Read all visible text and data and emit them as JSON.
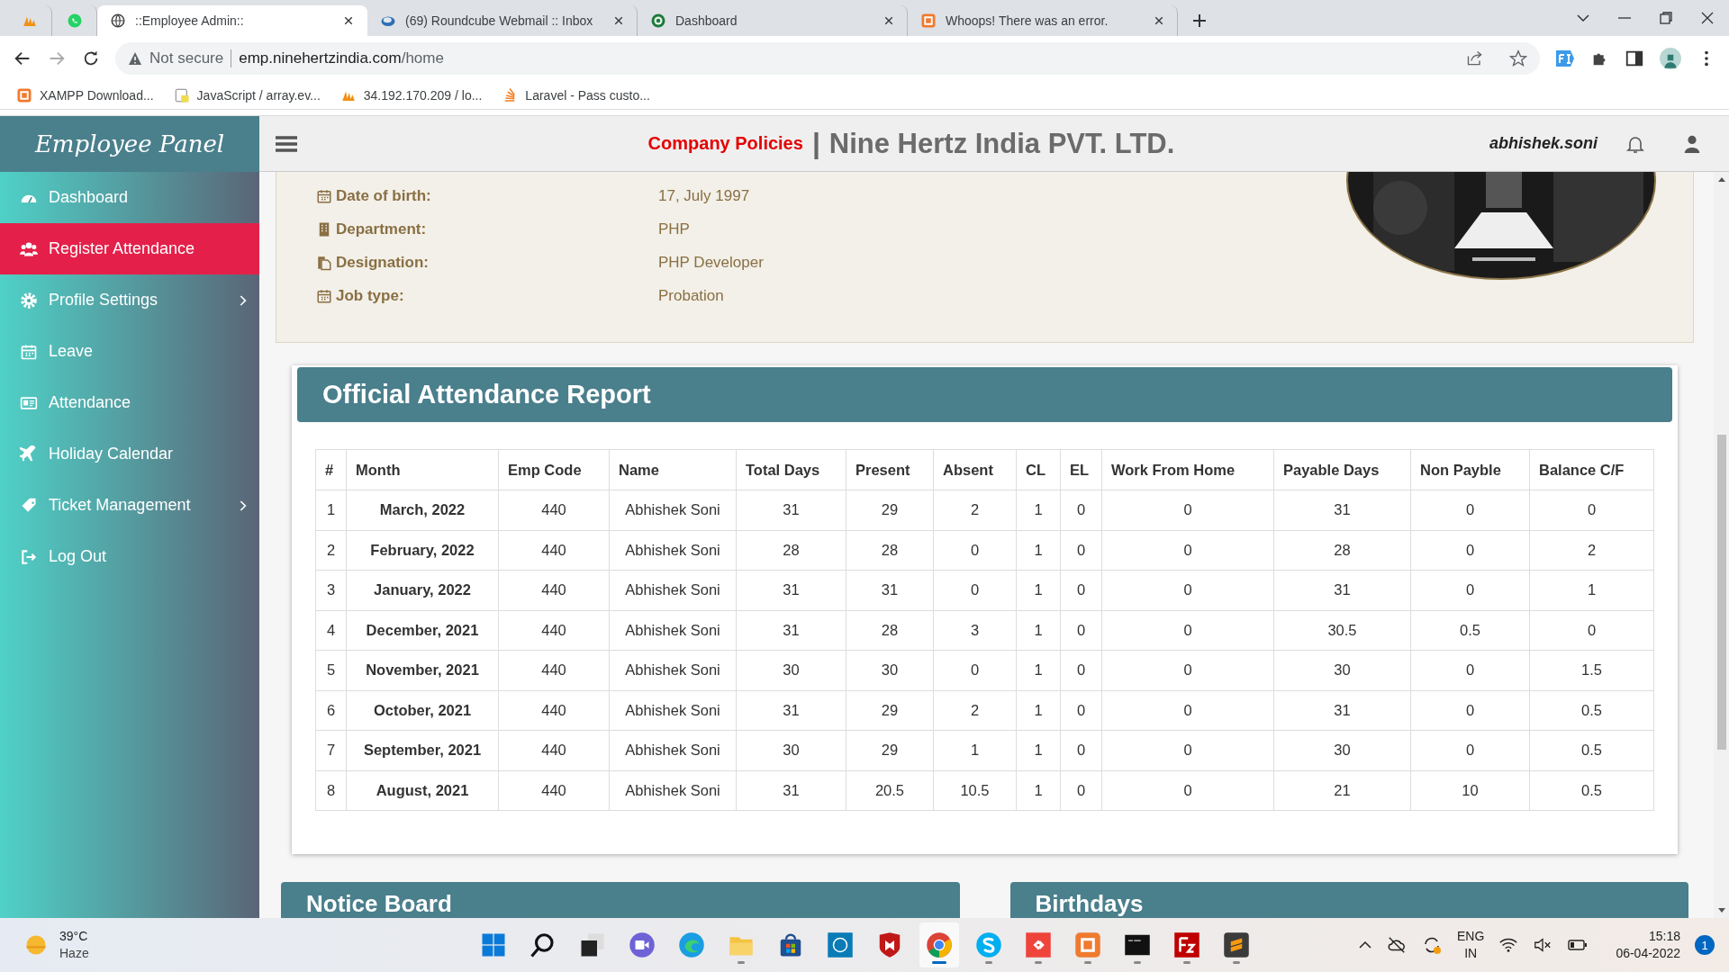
{
  "browser": {
    "tabs": [
      {
        "kind": "pinned",
        "selected": false
      },
      {
        "kind": "pinned",
        "selected": false
      },
      {
        "kind": "page",
        "title": "::Employee Admin::",
        "selected": true
      },
      {
        "kind": "page",
        "title": "(69) Roundcube Webmail :: Inbox",
        "selected": false
      },
      {
        "kind": "page",
        "title": "Dashboard",
        "selected": false
      },
      {
        "kind": "page",
        "title": "Whoops! There was an error.",
        "selected": false
      }
    ],
    "security": "Not secure",
    "url_host": "emp.ninehertzindia.com",
    "url_path": "/home",
    "bookmarks": [
      {
        "title": "XAMPP Download..."
      },
      {
        "title": "JavaScript / array.ev..."
      },
      {
        "title": "34.192.170.209 / lo..."
      },
      {
        "title": "Laravel - Pass custo..."
      }
    ]
  },
  "app": {
    "logo": "Employee Panel",
    "policies_link": "Company Policies",
    "separator": "|",
    "company": "Nine Hertz India PVT. LTD.",
    "user": "abhishek.soni"
  },
  "sidebar": {
    "items": [
      {
        "label": "Dashboard",
        "selected": false,
        "expandable": false
      },
      {
        "label": "Register Attendance",
        "selected": true,
        "expandable": false
      },
      {
        "label": "Profile Settings",
        "selected": false,
        "expandable": true
      },
      {
        "label": "Leave",
        "selected": false,
        "expandable": false
      },
      {
        "label": "Attendance",
        "selected": false,
        "expandable": false
      },
      {
        "label": "Holiday Calendar",
        "selected": false,
        "expandable": false
      },
      {
        "label": "Ticket Management",
        "selected": false,
        "expandable": true
      },
      {
        "label": "Log Out",
        "selected": false,
        "expandable": false
      }
    ]
  },
  "profile": {
    "fields": [
      {
        "label": "Date of birth:",
        "value": "17, July 1997"
      },
      {
        "label": "Department:",
        "value": "PHP"
      },
      {
        "label": "Designation:",
        "value": "PHP Developer"
      },
      {
        "label": "Job type:",
        "value": "Probation"
      }
    ]
  },
  "report": {
    "title": "Official Attendance Report",
    "columns": [
      "#",
      "Month",
      "Emp Code",
      "Name",
      "Total Days",
      "Present",
      "Absent",
      "CL",
      "EL",
      "Work From Home",
      "Payable Days",
      "Non Payble",
      "Balance C/F"
    ],
    "rows": [
      [
        "1",
        "March, 2022",
        "440",
        "Abhishek Soni",
        "31",
        "29",
        "2",
        "1",
        "0",
        "0",
        "31",
        "0",
        "0"
      ],
      [
        "2",
        "February, 2022",
        "440",
        "Abhishek Soni",
        "28",
        "28",
        "0",
        "1",
        "0",
        "0",
        "28",
        "0",
        "2"
      ],
      [
        "3",
        "January, 2022",
        "440",
        "Abhishek Soni",
        "31",
        "31",
        "0",
        "1",
        "0",
        "0",
        "31",
        "0",
        "1"
      ],
      [
        "4",
        "December, 2021",
        "440",
        "Abhishek Soni",
        "31",
        "28",
        "3",
        "1",
        "0",
        "0",
        "30.5",
        "0.5",
        "0"
      ],
      [
        "5",
        "November, 2021",
        "440",
        "Abhishek Soni",
        "30",
        "30",
        "0",
        "1",
        "0",
        "0",
        "30",
        "0",
        "1.5"
      ],
      [
        "6",
        "October, 2021",
        "440",
        "Abhishek Soni",
        "31",
        "29",
        "2",
        "1",
        "0",
        "0",
        "31",
        "0",
        "0.5"
      ],
      [
        "7",
        "September, 2021",
        "440",
        "Abhishek Soni",
        "30",
        "29",
        "1",
        "1",
        "0",
        "0",
        "30",
        "0",
        "0.5"
      ],
      [
        "8",
        "August, 2021",
        "440",
        "Abhishek Soni",
        "31",
        "20.5",
        "10.5",
        "1",
        "0",
        "0",
        "21",
        "10",
        "0.5"
      ]
    ]
  },
  "bottom_cards": [
    {
      "title": "Notice Board"
    },
    {
      "title": "Birthdays"
    }
  ],
  "taskbar": {
    "temperature": "39°C",
    "condition": "Haze",
    "apps": [
      {
        "running": false,
        "selected": false
      },
      {
        "running": false,
        "selected": false
      },
      {
        "running": false,
        "selected": false
      },
      {
        "running": false,
        "selected": false
      },
      {
        "running": false,
        "selected": false
      },
      {
        "running": true,
        "selected": false
      },
      {
        "running": false,
        "selected": false
      },
      {
        "running": false,
        "selected": false
      },
      {
        "running": false,
        "selected": false
      },
      {
        "running": true,
        "selected": true
      },
      {
        "running": true,
        "selected": false
      },
      {
        "running": true,
        "selected": false
      },
      {
        "running": true,
        "selected": false
      },
      {
        "running": true,
        "selected": false
      },
      {
        "running": true,
        "selected": false
      },
      {
        "running": true,
        "selected": false
      }
    ],
    "language": "ENG",
    "region": "IN",
    "time": "15:18",
    "date": "06-04-2022",
    "notifications": "1"
  }
}
